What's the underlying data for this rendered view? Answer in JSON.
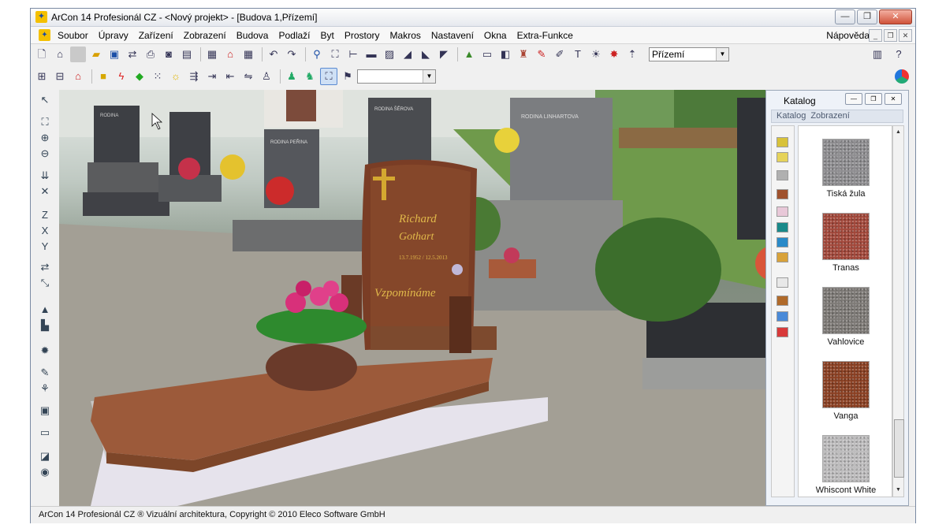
{
  "window": {
    "title": "ArCon 14 Profesionál CZ - <Nový projekt> - [Budova 1,Přízemí]"
  },
  "menu": {
    "items": [
      "Soubor",
      "Úpravy",
      "Zařízení",
      "Zobrazení",
      "Budova",
      "Podlaží",
      "Byt",
      "Prostory",
      "Makros",
      "Nastavení",
      "Okna",
      "Extra-Funkce"
    ],
    "help": "Nápověda"
  },
  "toolbar": {
    "floor_select": "Přízemí",
    "second_select": ""
  },
  "viewport": {
    "headstone_name": "Richard",
    "headstone_surname": "Gothart",
    "headstone_dates": "13.7.1952 / 12.5.2013",
    "headstone_epitaph": "Vzpomínáme",
    "bg_grave_1": "RODINA ŠĚROVA",
    "bg_grave_2": "RODINA LINHARTOVA",
    "bg_grave_3": "RODINA PEŘINA"
  },
  "catalog": {
    "title": "Katalog",
    "menu": [
      "Katalog",
      "Zobrazení"
    ],
    "items": [
      {
        "label": "Tiská žula",
        "color": "#8e8d90"
      },
      {
        "label": "Tranas",
        "color": "#a2473a"
      },
      {
        "label": "Vahlovice",
        "color": "#7d7a76"
      },
      {
        "label": "Vanga",
        "color": "#8a3f22"
      },
      {
        "label": "Whiscont White",
        "color": "#bdbcbd"
      }
    ]
  },
  "statusbar": {
    "text": "ArCon 14 Profesionál CZ ® Vizuální architektura, Copyright © 2010 Eleco Software GmbH"
  }
}
